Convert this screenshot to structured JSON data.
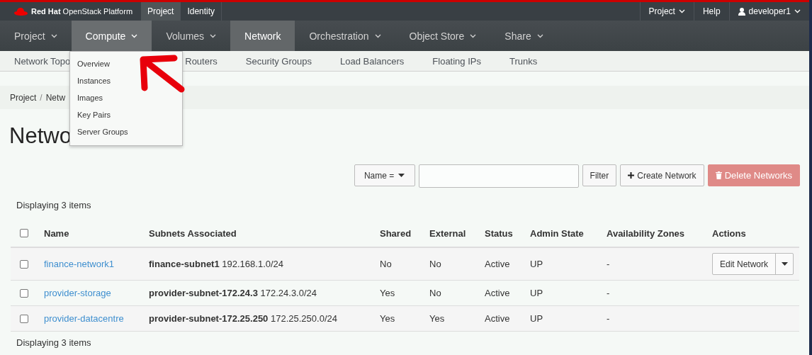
{
  "topbar": {
    "brand": "**Red Hat** OpenStack Platform",
    "tabs": [
      {
        "label": "Project",
        "selected": true
      },
      {
        "label": "Identity",
        "selected": false
      }
    ],
    "right": [
      {
        "label": "Project",
        "kind": "dropdown"
      },
      {
        "label": "Help",
        "kind": "link"
      },
      {
        "label": "developer1",
        "kind": "user"
      }
    ]
  },
  "nav": [
    {
      "label": "Project",
      "selected": false,
      "expanded": false
    },
    {
      "label": "Compute",
      "selected": false,
      "expanded": true
    },
    {
      "label": "Volumes",
      "selected": false,
      "expanded": false
    },
    {
      "label": "Network",
      "selected": true,
      "expanded": false
    },
    {
      "label": "Orchestration",
      "selected": false,
      "expanded": false
    },
    {
      "label": "Object Store",
      "selected": false,
      "expanded": false
    },
    {
      "label": "Share",
      "selected": false,
      "expanded": false
    }
  ],
  "subnav": [
    "Network Topo",
    "Routers",
    "Security Groups",
    "Load Balancers",
    "Floating IPs",
    "Trunks"
  ],
  "menu": [
    "Overview",
    "Instances",
    "Images",
    "Key Pairs",
    "Server Groups"
  ],
  "breadcrumb": [
    "Project",
    "/",
    "Netw"
  ],
  "heading": "Netwo",
  "toolbar": {
    "filter_select": "Name =",
    "filter_button": "Filter",
    "create_button": "Create Network",
    "delete_button": "Delete Networks",
    "delete_disabled": true
  },
  "count_top": "Displaying 3 items",
  "table": {
    "columns": [
      "Name",
      "Subnets Associated",
      "Shared",
      "External",
      "Status",
      "Admin State",
      "Availability Zones",
      "Actions"
    ],
    "header_checked": false,
    "rows": [
      {
        "checked": false,
        "name": "finance-network1",
        "subnets": "**finance-subnet1** 192.168.1.0/24",
        "shared": "No",
        "external": "No",
        "status": "Active",
        "admin_state": "UP",
        "zones": "-",
        "action": "Edit Network"
      },
      {
        "checked": false,
        "name": "provider-storage",
        "subnets": "**provider-subnet-172.24.3** 172.24.3.0/24",
        "shared": "Yes",
        "external": "No",
        "status": "Active",
        "admin_state": "UP",
        "zones": "-"
      },
      {
        "checked": false,
        "name": "provider-datacentre",
        "subnets": "**provider-subnet-172.25.250** 172.25.250.0/24",
        "shared": "Yes",
        "external": "Yes",
        "status": "Active",
        "admin_state": "UP",
        "zones": "-"
      }
    ]
  },
  "count_bottom": "Displaying 3 items"
}
